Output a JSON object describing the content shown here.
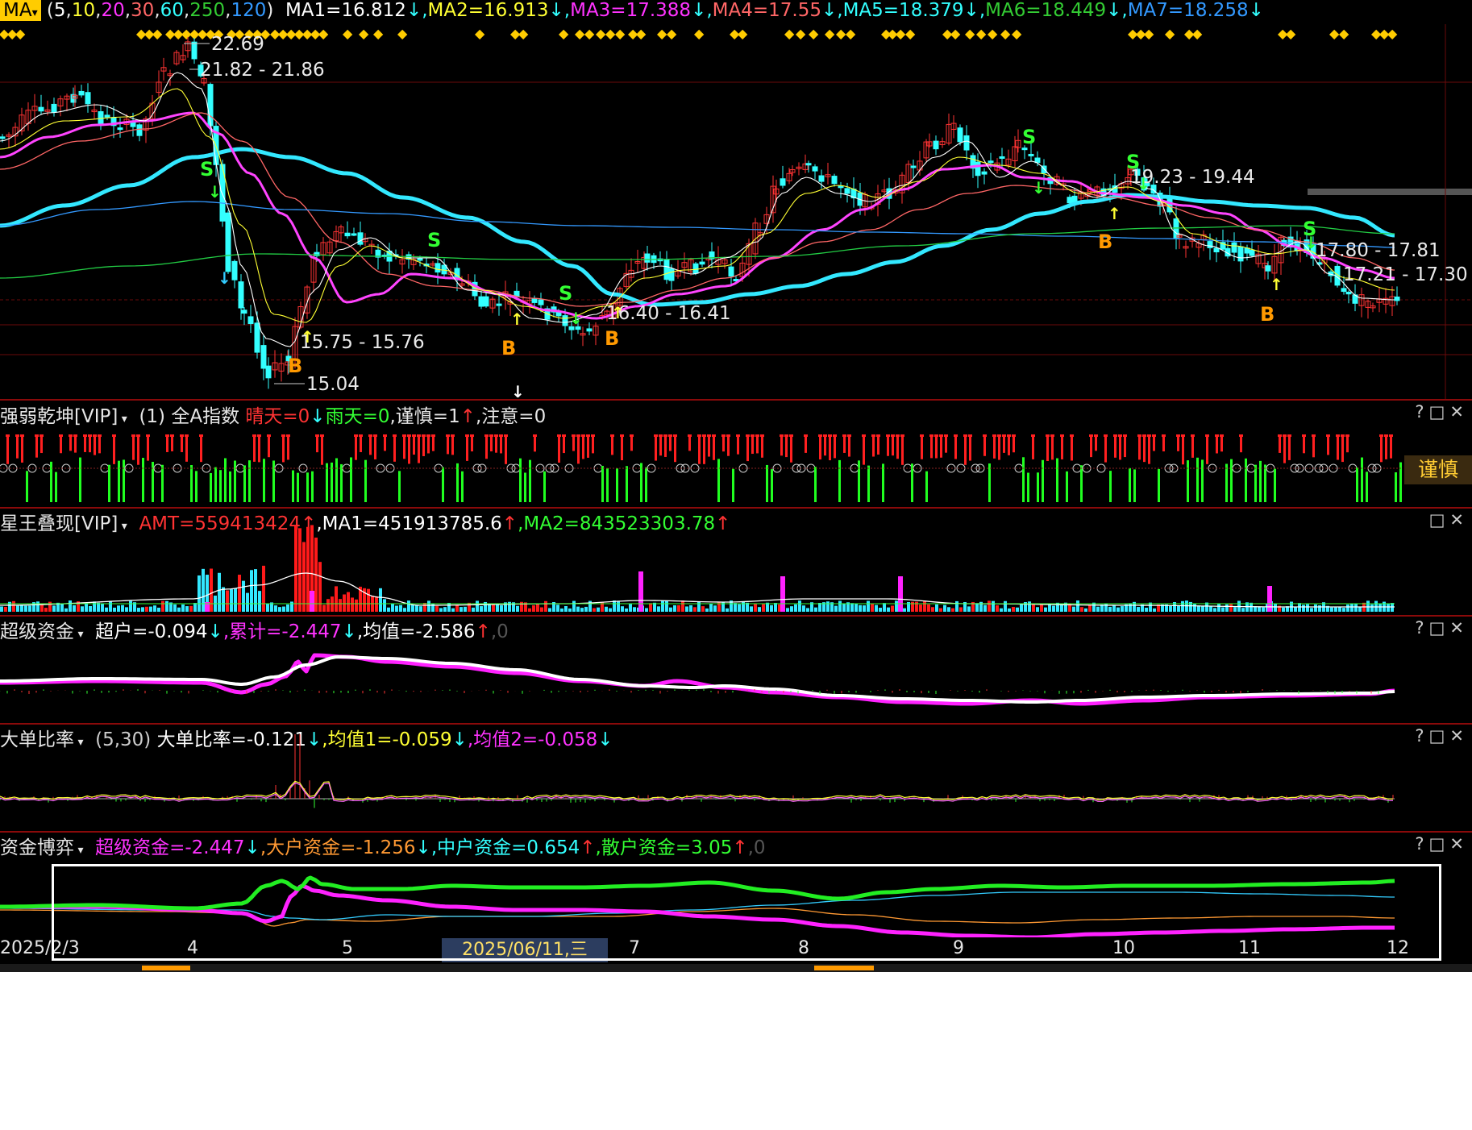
{
  "main": {
    "indicator_dropdown": "MA",
    "params": [
      {
        "text": "(",
        "color": "#e6e6e6"
      },
      {
        "text": "5",
        "color": "#ffffff"
      },
      {
        "text": ",",
        "color": "#e6e6e6"
      },
      {
        "text": "10",
        "color": "#ffff33"
      },
      {
        "text": ",",
        "color": "#e6e6e6"
      },
      {
        "text": "20",
        "color": "#ff33ff"
      },
      {
        "text": ",",
        "color": "#e6e6e6"
      },
      {
        "text": "30",
        "color": "#ff6666"
      },
      {
        "text": ",",
        "color": "#e6e6e6"
      },
      {
        "text": "60",
        "color": "#33ffff"
      },
      {
        "text": ",",
        "color": "#e6e6e6"
      },
      {
        "text": "250",
        "color": "#33cc33"
      },
      {
        "text": ",",
        "color": "#e6e6e6"
      },
      {
        "text": "120",
        "color": "#3399ff"
      },
      {
        "text": ")",
        "color": "#e6e6e6"
      }
    ],
    "ma_values": [
      {
        "text": "MA1=16.812",
        "color": "#ffffff",
        "arrow": "↓",
        "arrow_color": "#33ffff"
      },
      {
        "text": "MA2=16.913",
        "color": "#ffff33",
        "arrow": "↓",
        "arrow_color": "#33ffff"
      },
      {
        "text": "MA3=17.388",
        "color": "#ff33ff",
        "arrow": "↓",
        "arrow_color": "#33ffff"
      },
      {
        "text": "MA4=17.55",
        "color": "#ff6666",
        "arrow": "↓",
        "arrow_color": "#33ffff"
      },
      {
        "text": "MA5=18.379",
        "color": "#33ffff",
        "arrow": "↓",
        "arrow_color": "#33ffff"
      },
      {
        "text": "MA6=18.449",
        "color": "#33cc33",
        "arrow": "↓",
        "arrow_color": "#33ffff"
      },
      {
        "text": "MA7=18.258",
        "color": "#3399ff",
        "arrow": "↓",
        "arrow_color": "#33ffff"
      }
    ],
    "price_labels": [
      "22.69",
      "21.82 - 21.86",
      "15.75 - 15.76",
      "15.04",
      "16.40 - 16.41",
      "19.23 - 19.44",
      "17.80 - 17.81",
      "17.21 - 17.30"
    ],
    "signal_s": "S",
    "signal_b": "B"
  },
  "panels": {
    "p2": {
      "name": "强弱乾坤[VIP]",
      "segments": [
        {
          "text": " (1) 全A指数 ",
          "color": "#e6e6e6"
        },
        {
          "text": "晴天=0",
          "color": "#ff3333"
        },
        {
          "text": "↓",
          "color": "#33ffff"
        },
        {
          "text": "雨天=0",
          "color": "#33ff33"
        },
        {
          "text": ",谨慎=1",
          "color": "#e6e6e6"
        },
        {
          "text": "↑",
          "color": "#ff3333"
        },
        {
          "text": ",注意=0",
          "color": "#e6e6e6"
        }
      ],
      "badge": "谨慎",
      "controls": "?□✕"
    },
    "p3": {
      "name": "星王叠现[VIP]",
      "segments": [
        {
          "text": " AMT=559413424",
          "color": "#ff3333"
        },
        {
          "text": "↑",
          "color": "#ff3333"
        },
        {
          "text": ",MA1=451913785.6",
          "color": "#ffffff"
        },
        {
          "text": "↑",
          "color": "#ff3333"
        },
        {
          "text": ",MA2=843523303.78",
          "color": "#33ff33"
        },
        {
          "text": "↑",
          "color": "#ff3333"
        }
      ],
      "controls": "□✕"
    },
    "p4": {
      "name": "超级资金",
      "segments": [
        {
          "text": " 超户=-0.094",
          "color": "#ffffff"
        },
        {
          "text": "↓",
          "color": "#33ffff"
        },
        {
          "text": ",累计=-2.447",
          "color": "#ff33ff"
        },
        {
          "text": "↓",
          "color": "#33ffff"
        },
        {
          "text": ",均值=-2.586",
          "color": "#ffffff"
        },
        {
          "text": "↑",
          "color": "#ff3333"
        },
        {
          "text": ",0",
          "color": "#555555"
        }
      ],
      "controls": "?□✕"
    },
    "p5": {
      "name": "大单比率",
      "segments": [
        {
          "text": " (5,30) ",
          "color": "#cccccc"
        },
        {
          "text": "大单比率=-0.121",
          "color": "#ffffff"
        },
        {
          "text": "↓",
          "color": "#33ffff"
        },
        {
          "text": ",均值1=-0.059",
          "color": "#ffff33"
        },
        {
          "text": "↓",
          "color": "#33ffff"
        },
        {
          "text": ",均值2=-0.058",
          "color": "#ff33ff"
        },
        {
          "text": "↓",
          "color": "#33ffff"
        }
      ],
      "controls": "?□✕"
    },
    "p6": {
      "name": "资金博弈",
      "segments": [
        {
          "text": " 超级资金=-2.447",
          "color": "#ff33ff"
        },
        {
          "text": "↓",
          "color": "#33ffff"
        },
        {
          "text": ",大户资金=-1.256",
          "color": "#ff9933"
        },
        {
          "text": "↓",
          "color": "#33ffff"
        },
        {
          "text": ",中户资金=0.654",
          "color": "#33ffff"
        },
        {
          "text": "↑",
          "color": "#ff3333"
        },
        {
          "text": ",散户资金=3.05",
          "color": "#33ff33"
        },
        {
          "text": "↑",
          "color": "#ff3333"
        },
        {
          "text": ",0",
          "color": "#555555"
        }
      ],
      "controls": "?□✕"
    }
  },
  "x_axis": {
    "labels": [
      "2025/2/3",
      "4",
      "5",
      "7",
      "8",
      "9",
      "10",
      "11",
      "12"
    ],
    "cursor_date": "2025/06/11,三"
  },
  "colors": {
    "up": "#ff3333",
    "down": "#33ffff",
    "grid": "#8a0a0a",
    "diamond": "#ffcc00"
  }
}
